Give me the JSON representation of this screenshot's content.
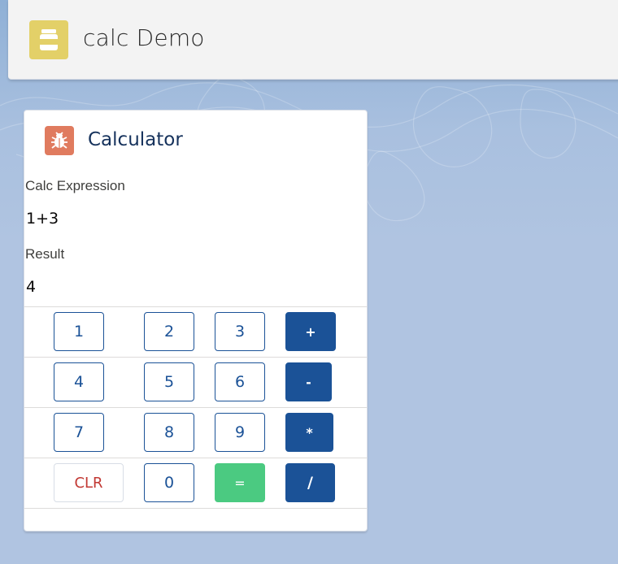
{
  "header": {
    "app_title": "calc Demo",
    "app_icon": "product-icon"
  },
  "card": {
    "title": "Calculator",
    "icon": "bug-icon",
    "expression_label": "Calc Expression",
    "expression_value": "1+3",
    "result_label": "Result",
    "result_value": "4"
  },
  "keypad": {
    "row1": [
      "1",
      "2",
      "3",
      "+"
    ],
    "row2": [
      "4",
      "5",
      "6",
      "-"
    ],
    "row3": [
      "7",
      "8",
      "9",
      "*"
    ],
    "row4": [
      "CLR",
      "0",
      "=",
      "/"
    ]
  },
  "colors": {
    "brand_blue": "#1b5297",
    "equals_green": "#4bca81",
    "clear_red": "#c23934",
    "app_icon_yellow": "#e3d068",
    "card_icon_orange": "#e07b5f"
  }
}
